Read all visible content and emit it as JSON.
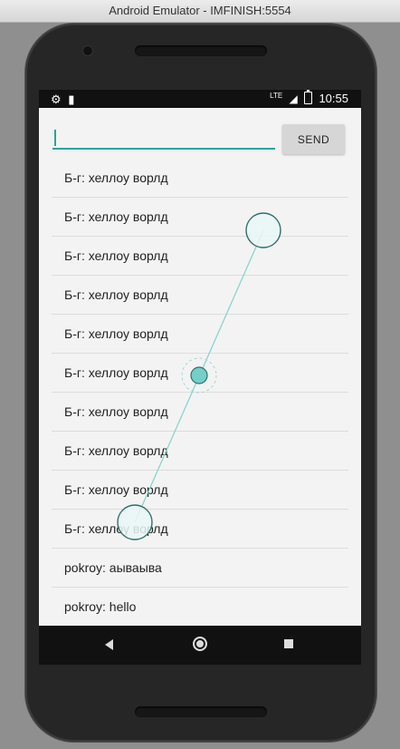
{
  "window": {
    "title": "Android Emulator - IMFINISH:5554"
  },
  "statusbar": {
    "icons_left": [
      "gear-icon",
      "sdcard-icon"
    ],
    "lte": "LTE",
    "battery_icon": "battery-icon",
    "time": "10:55"
  },
  "composer": {
    "input_value": "",
    "send_label": "SEND",
    "accent_color": "#26a69a"
  },
  "messages": [
    "Б-г: хеллоу ворлд",
    "Б-г: хеллоу ворлд",
    "Б-г: хеллоу ворлд",
    "Б-г: хеллоу ворлд",
    "Б-г: хеллоу ворлд",
    "Б-г: хеллоу ворлд",
    "Б-г: хеллоу ворлд",
    "Б-г: хеллоу ворлд",
    "Б-г: хеллоу ворлд",
    "Б-г: хеллоу ворлд",
    "pokroy: аываыва",
    "pokroy: hello"
  ],
  "navbar": {
    "icons": [
      "back-icon",
      "home-icon",
      "recents-icon"
    ]
  }
}
